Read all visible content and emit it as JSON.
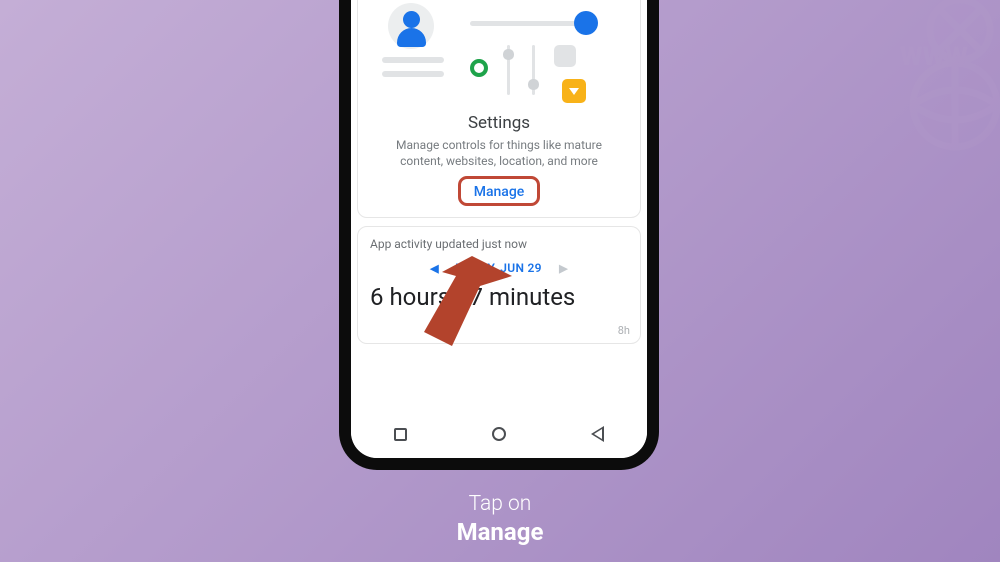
{
  "settings_card": {
    "title": "Settings",
    "description": "Manage controls for things like mature content, websites, location, and more",
    "manage_label": "Manage"
  },
  "activity_card": {
    "status_text": "App activity updated just now",
    "date_label": "TODAY, JUN 29",
    "total_time": "6 hours 37 minutes",
    "axis_max_label": "8h"
  },
  "instruction": {
    "line1": "Tap on",
    "line2": "Manage"
  }
}
